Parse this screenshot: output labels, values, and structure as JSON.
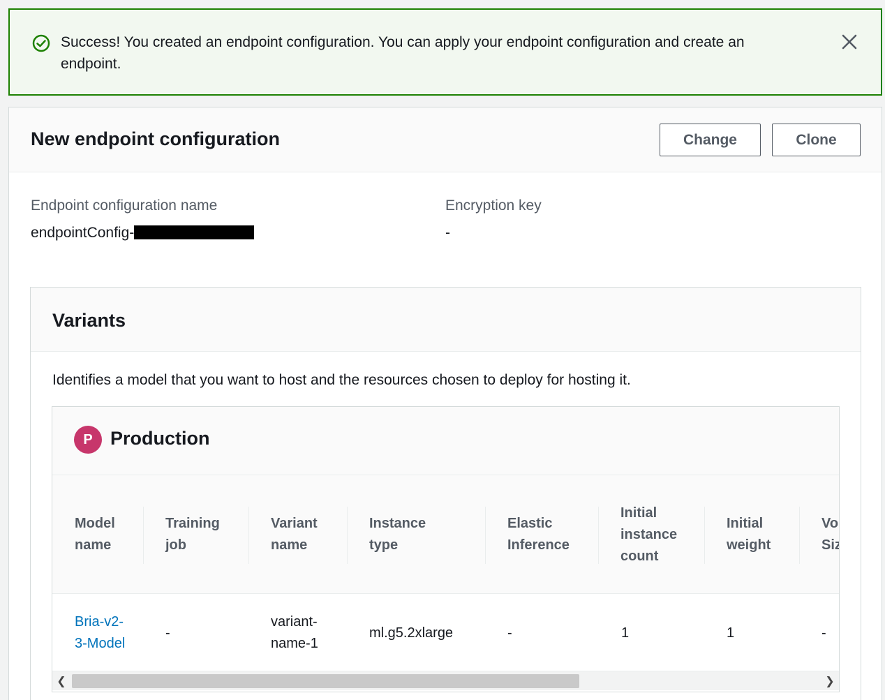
{
  "flash": {
    "icon": "check-circle-icon",
    "message": "Success! You created an endpoint configuration. You can apply your endpoint configuration and create an endpoint.",
    "close_icon": "close-icon",
    "color": "#1d8102"
  },
  "header": {
    "title": "New endpoint configuration",
    "change_label": "Change",
    "clone_label": "Clone"
  },
  "details": {
    "name_label": "Endpoint configuration name",
    "name_value": "endpointConfig-",
    "encryption_label": "Encryption key",
    "encryption_value": "-"
  },
  "variants": {
    "title": "Variants",
    "description": "Identifies a model that you want to host and the resources chosen to deploy for hosting it.",
    "production": {
      "badge": "P",
      "badge_color": "#c7366b",
      "title": "Production",
      "columns": [
        "Model name",
        "Training job",
        "Variant name",
        "Instance type",
        "Elastic Inference",
        "Initial instance count",
        "Initial weight",
        "Volume Size"
      ],
      "row": {
        "model_name": "Bria-v2-3-Model",
        "training_job": "-",
        "variant_name": "variant-name-1",
        "instance_type": "ml.g5.2xlarge",
        "elastic_inference": "-",
        "initial_instance_count": "1",
        "initial_weight": "1",
        "volume_size": "-"
      }
    }
  },
  "link_color": "#0073bb"
}
